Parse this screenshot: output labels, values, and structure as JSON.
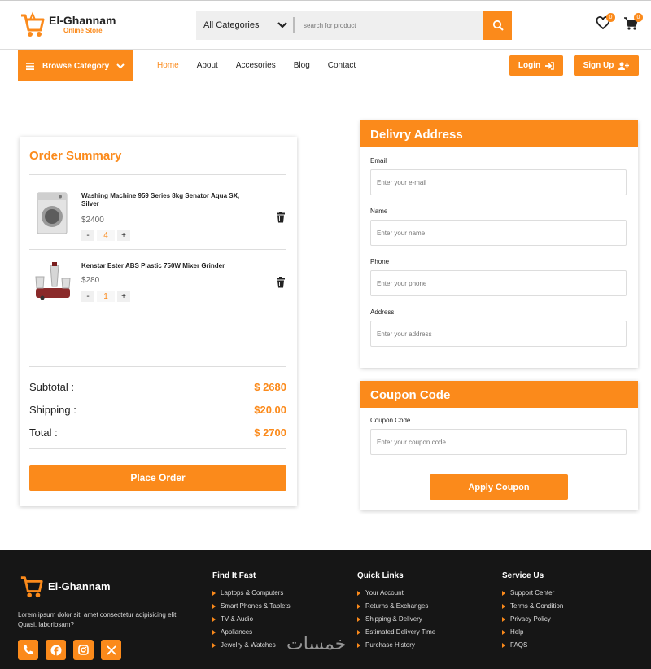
{
  "header": {
    "brand_title": "El-Ghannam",
    "brand_sub": "Online Store",
    "category_select": "All Categories",
    "search_placeholder": "search for product",
    "wishlist_count": "0",
    "cart_count": "0"
  },
  "nav": {
    "browse_label": "Browse Category",
    "links": [
      "Home",
      "About",
      "Accesories",
      "Blog",
      "Contact"
    ],
    "active": "Home",
    "login_label": "Login",
    "signup_label": "Sign Up"
  },
  "order": {
    "title": "Order Summary",
    "items": [
      {
        "name": "Washing Machine 959 Series 8kg Senator Aqua SX, Silver",
        "price": "$2400",
        "qty": "4"
      },
      {
        "name": "Kenstar Ester ABS Plastic 750W Mixer Grinder",
        "price": "$280",
        "qty": "1"
      }
    ],
    "minus": "-",
    "plus": "+",
    "subtotal_label": "Subtotal :",
    "subtotal_value": "$ 2680",
    "shipping_label": "Shipping :",
    "shipping_value": "$20.00",
    "total_label": "Total :",
    "total_value": "$ 2700",
    "place_label": "Place Order"
  },
  "delivery": {
    "title": "Delivry Address",
    "fields": [
      {
        "label": "Email",
        "placeholder": "Enter your e-mail"
      },
      {
        "label": "Name",
        "placeholder": "Enter your name"
      },
      {
        "label": "Phone",
        "placeholder": "Enter your phone"
      },
      {
        "label": "Address",
        "placeholder": "Enter your address"
      }
    ]
  },
  "coupon": {
    "title": "Coupon Code",
    "label": "Coupon Code",
    "placeholder": "Enter your coupon code",
    "apply_label": "Apply Coupon"
  },
  "footer": {
    "brand_title": "El-Ghannam",
    "about": "Lorem ipsum dolor sit, amet consectetur adipisicing elit. Quasi, laboriosam?",
    "columns": [
      {
        "title": "Find It Fast",
        "items": [
          "Laptops & Computers",
          "Smart Phones & Tablets",
          "TV & Audio",
          "Appliances",
          "Jewelry & Watches"
        ]
      },
      {
        "title": "Quick Links",
        "items": [
          "Your Account",
          "Returns & Exchanges",
          "Shipping & Delivery",
          "Estimated Delivery Time",
          "Purchase History"
        ]
      },
      {
        "title": "Service Us",
        "items": [
          "Support Center",
          "Terms & Condition",
          "Privacy Policy",
          "Help",
          "FAQS"
        ]
      }
    ],
    "watermark": "خمسات"
  },
  "colors": {
    "accent": "#fb8a1b",
    "footer_bg": "#161616"
  }
}
